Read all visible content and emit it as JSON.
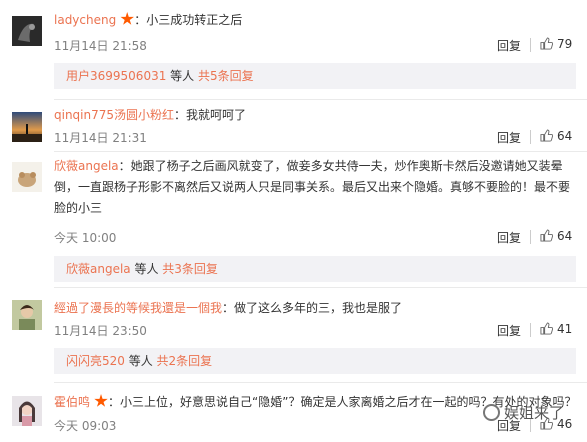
{
  "comments": [
    {
      "username": "ladycheng",
      "has_badge": true,
      "text": "：小三成功转正之后",
      "timestamp": "11月14日 21:58",
      "reply_label": "回复",
      "likes": "79",
      "replies": {
        "user": "用户3699506031",
        "count_text": " 等人 ",
        "total": "共5条回复"
      }
    },
    {
      "username": "qinqin775汤圆小粉红",
      "has_badge": false,
      "text": "：我就呵呵了",
      "timestamp": "11月14日 21:31",
      "reply_label": "回复",
      "likes": "64"
    },
    {
      "username": "欣薇angela",
      "has_badge": false,
      "text": "：她跟了杨子之后画风就变了，做妾多女共侍一夫，炒作奥斯卡然后没邀请她又装晕倒，一直跟杨子形影不离然后又说两人只是同事关系。最后又出来个隐婚。真够不要脸的！最不要脸的小三",
      "timestamp": "今天 10:00",
      "reply_label": "回复",
      "likes": "64",
      "replies": {
        "user": "欣薇angela",
        "count_text": " 等人 ",
        "total": "共3条回复"
      }
    },
    {
      "username": "經過了漫長的等候我還是一個我",
      "has_badge": false,
      "text": "：做了这么多年的三，我也是服了",
      "timestamp": "11月14日 23:50",
      "reply_label": "回复",
      "likes": "41",
      "replies": {
        "user": "闪闪亮520",
        "count_text": " 等人 ",
        "total": "共2条回复"
      }
    },
    {
      "username": "霍伯鸣",
      "has_badge": true,
      "text": "：小三上位，好意思说自己“隐婚”？确定是人家离婚之后才在一起的吗？有处的对象吗？",
      "timestamp": "今天 09:03",
      "reply_label": "回复",
      "likes": "46"
    }
  ],
  "watermark": "娱姐来了",
  "colors": {
    "username": "#eb7350",
    "badge": "#ff5a00",
    "reply_box": "#f2f2f5",
    "meta": "#808080"
  }
}
